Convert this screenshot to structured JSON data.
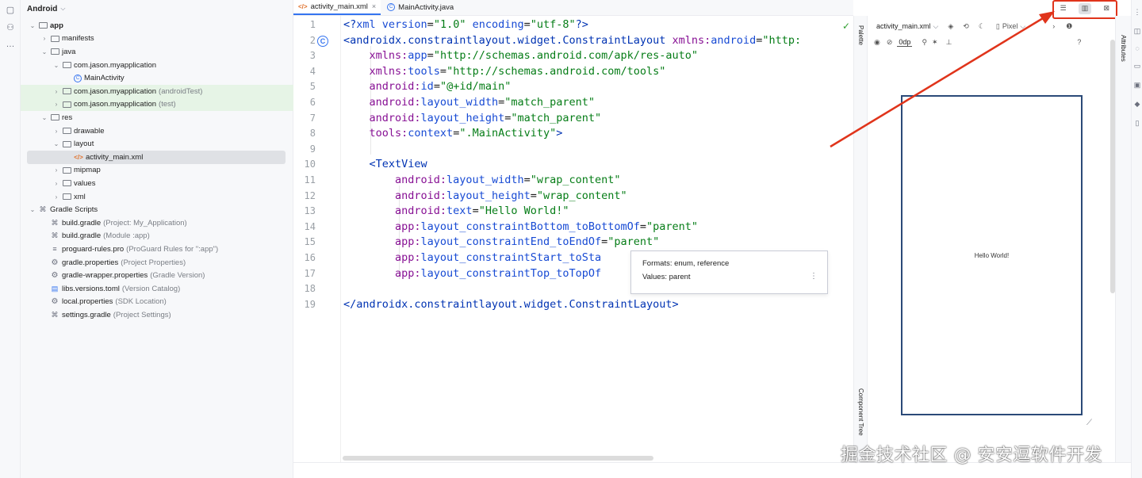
{
  "project": {
    "title": "Android",
    "tree": [
      {
        "label": "app",
        "sub": "",
        "icon": "folder",
        "depth": 0,
        "bold": true
      },
      {
        "label": "manifests",
        "sub": "",
        "icon": "folder",
        "depth": 1
      },
      {
        "label": "java",
        "sub": "",
        "icon": "folder",
        "depth": 1
      },
      {
        "label": "com.jason.myapplication",
        "sub": "",
        "icon": "folder",
        "depth": 2
      },
      {
        "label": "MainActivity",
        "sub": "",
        "icon": "class",
        "depth": 3
      },
      {
        "label": "com.jason.myapplication",
        "sub": "(androidTest)",
        "icon": "folder",
        "depth": 2,
        "highlight": true
      },
      {
        "label": "com.jason.myapplication",
        "sub": "(test)",
        "icon": "folder",
        "depth": 2,
        "highlight": true
      },
      {
        "label": "res",
        "sub": "",
        "icon": "folder",
        "depth": 1
      },
      {
        "label": "drawable",
        "sub": "",
        "icon": "folder",
        "depth": 2
      },
      {
        "label": "layout",
        "sub": "",
        "icon": "folder",
        "depth": 2
      },
      {
        "label": "activity_main.xml",
        "sub": "",
        "icon": "xml",
        "depth": 3,
        "selected": true
      },
      {
        "label": "mipmap",
        "sub": "",
        "icon": "folder",
        "depth": 2
      },
      {
        "label": "values",
        "sub": "",
        "icon": "folder",
        "depth": 2
      },
      {
        "label": "xml",
        "sub": "",
        "icon": "folder",
        "depth": 2
      },
      {
        "label": "Gradle Scripts",
        "sub": "",
        "icon": "gradle",
        "depth": 0
      },
      {
        "label": "build.gradle",
        "sub": "(Project: My_Application)",
        "icon": "gradle",
        "depth": 1
      },
      {
        "label": "build.gradle",
        "sub": "(Module :app)",
        "icon": "gradle",
        "depth": 1
      },
      {
        "label": "proguard-rules.pro",
        "sub": "(ProGuard Rules for \":app\")",
        "icon": "file",
        "depth": 1
      },
      {
        "label": "gradle.properties",
        "sub": "(Project Properties)",
        "icon": "gear",
        "depth": 1
      },
      {
        "label": "gradle-wrapper.properties",
        "sub": "(Gradle Version)",
        "icon": "gear",
        "depth": 1
      },
      {
        "label": "libs.versions.toml",
        "sub": "(Version Catalog)",
        "icon": "toml",
        "depth": 1
      },
      {
        "label": "local.properties",
        "sub": "(SDK Location)",
        "icon": "gear",
        "depth": 1
      },
      {
        "label": "settings.gradle",
        "sub": "(Project Settings)",
        "icon": "gradle",
        "depth": 1
      }
    ]
  },
  "tabs": [
    {
      "label": "activity_main.xml",
      "active": true,
      "icon": "xml-icon"
    },
    {
      "label": "MainActivity.java",
      "active": false,
      "icon": "class-icon"
    }
  ],
  "editor": {
    "line_numbers": [
      "1",
      "2",
      "3",
      "4",
      "5",
      "6",
      "7",
      "8",
      "9",
      "10",
      "11",
      "12",
      "13",
      "14",
      "15",
      "16",
      "17",
      "18",
      "19"
    ],
    "gutter_mark_line": "2",
    "lines": [
      [
        {
          "t": "<?",
          "c": "c-pi"
        },
        {
          "t": "xml version",
          "c": "c-attr"
        },
        {
          "t": "=",
          "c": ""
        },
        {
          "t": "\"1.0\"",
          "c": "c-str"
        },
        {
          "t": " encoding",
          "c": "c-attr"
        },
        {
          "t": "=",
          "c": ""
        },
        {
          "t": "\"utf-8\"",
          "c": "c-str"
        },
        {
          "t": "?>",
          "c": "c-pi"
        }
      ],
      [
        {
          "t": "<androidx.constraintlayout.widget.ConstraintLayout ",
          "c": "c-tag"
        },
        {
          "t": "xmlns:",
          "c": "c-attr-ns"
        },
        {
          "t": "android",
          "c": "c-attr"
        },
        {
          "t": "=",
          "c": ""
        },
        {
          "t": "\"http:",
          "c": "c-str"
        }
      ],
      [
        {
          "t": "    xmlns:",
          "c": "c-attr-ns"
        },
        {
          "t": "app",
          "c": "c-attr"
        },
        {
          "t": "=",
          "c": ""
        },
        {
          "t": "\"http://schemas.android.com/apk/res-auto\"",
          "c": "c-str"
        }
      ],
      [
        {
          "t": "    xmlns:",
          "c": "c-attr-ns"
        },
        {
          "t": "tools",
          "c": "c-attr"
        },
        {
          "t": "=",
          "c": ""
        },
        {
          "t": "\"http://schemas.android.com/tools\"",
          "c": "c-str"
        }
      ],
      [
        {
          "t": "    android:",
          "c": "c-attr-ns"
        },
        {
          "t": "id",
          "c": "c-attr"
        },
        {
          "t": "=",
          "c": ""
        },
        {
          "t": "\"@+id/main\"",
          "c": "c-str"
        }
      ],
      [
        {
          "t": "    android:",
          "c": "c-attr-ns"
        },
        {
          "t": "layout_width",
          "c": "c-attr"
        },
        {
          "t": "=",
          "c": ""
        },
        {
          "t": "\"match_parent\"",
          "c": "c-str"
        }
      ],
      [
        {
          "t": "    android:",
          "c": "c-attr-ns"
        },
        {
          "t": "layout_height",
          "c": "c-attr"
        },
        {
          "t": "=",
          "c": ""
        },
        {
          "t": "\"match_parent\"",
          "c": "c-str"
        }
      ],
      [
        {
          "t": "    tools:",
          "c": "c-attr-ns"
        },
        {
          "t": "context",
          "c": "c-attr"
        },
        {
          "t": "=",
          "c": ""
        },
        {
          "t": "\".MainActivity\"",
          "c": "c-str"
        },
        {
          "t": ">",
          "c": "c-tag"
        }
      ],
      [],
      [
        {
          "t": "    <TextView",
          "c": "c-tag"
        }
      ],
      [
        {
          "t": "        android:",
          "c": "c-attr-ns"
        },
        {
          "t": "layout_width",
          "c": "c-attr"
        },
        {
          "t": "=",
          "c": ""
        },
        {
          "t": "\"wrap_content\"",
          "c": "c-str"
        }
      ],
      [
        {
          "t": "        android:",
          "c": "c-attr-ns"
        },
        {
          "t": "layout_height",
          "c": "c-attr"
        },
        {
          "t": "=",
          "c": ""
        },
        {
          "t": "\"wrap_content\"",
          "c": "c-str"
        }
      ],
      [
        {
          "t": "        android:",
          "c": "c-attr-ns"
        },
        {
          "t": "text",
          "c": "c-attr"
        },
        {
          "t": "=",
          "c": ""
        },
        {
          "t": "\"Hello World!\"",
          "c": "c-str"
        }
      ],
      [
        {
          "t": "        app:",
          "c": "c-attr-ns"
        },
        {
          "t": "layout_constraintBottom_toBottomOf",
          "c": "c-attr"
        },
        {
          "t": "=",
          "c": ""
        },
        {
          "t": "\"parent\"",
          "c": "c-str"
        }
      ],
      [
        {
          "t": "        app:",
          "c": "c-attr-ns"
        },
        {
          "t": "layout_constraintEnd_toEndOf",
          "c": "c-attr"
        },
        {
          "t": "=",
          "c": ""
        },
        {
          "t": "\"parent\"",
          "c": "c-str"
        }
      ],
      [
        {
          "t": "        app:",
          "c": "c-attr-ns"
        },
        {
          "t": "layout_constraintStart_toSta",
          "c": "c-attr"
        }
      ],
      [
        {
          "t": "        app:",
          "c": "c-attr-ns"
        },
        {
          "t": "layout_constraintTop_toTopOf",
          "c": "c-attr"
        }
      ],
      [],
      [
        {
          "t": "</androidx.constraintlayout.widget.ConstraintLayout>",
          "c": "c-tag"
        }
      ]
    ]
  },
  "tooltip": {
    "formats": "Formats: enum, reference",
    "values": "Values: parent",
    "menu": "⋮"
  },
  "palette_label": "Palette",
  "component_tree_label": "Component Tree",
  "attributes_label": "Attributes",
  "design": {
    "file_label": "activity_main.xml",
    "device_label": "Pixel",
    "dp_value": "0dp",
    "hello_text": "Hello World!",
    "help": "?",
    "info": "❶"
  },
  "mode_buttons": [
    {
      "name": "code-mode-button",
      "glyph": "☰",
      "active": false
    },
    {
      "name": "split-mode-button",
      "glyph": "▥",
      "active": true
    },
    {
      "name": "design-mode-button",
      "glyph": "⊠",
      "active": false
    }
  ],
  "watermark": "掘金技术社区 @ 安安逗软件开发",
  "colors": {
    "accent": "#3574f0",
    "annotation_red": "#e0341b",
    "device_frame": "#2b4a78"
  }
}
